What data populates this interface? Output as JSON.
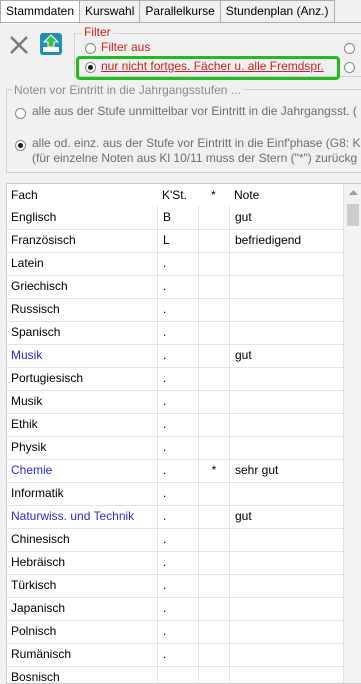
{
  "tabs": [
    "Stammdaten",
    "Kurswahl",
    "Parallelkurse",
    "Stundenplan (Anz.)"
  ],
  "filter": {
    "legend": "Filter",
    "option1": "Filter aus",
    "option2": "nur nicht fortges. Fächer u. alle Fremdspr."
  },
  "noten": {
    "legend": "Noten vor Eintritt in die Jahrgangsstufen ...",
    "option1": "alle aus der Stufe unmittelbar vor Eintritt in die Jahrgangsst. (",
    "option2_line1": "alle od. einz. aus der Stufe vor Eintritt in die Einf'phase (G8: K",
    "option2_line2": "(für einzelne Noten aus Kl 10/11 muss der Stern (\"*\") zurückg"
  },
  "table": {
    "headers": [
      "Fach",
      "K'St.",
      "*",
      "Note"
    ],
    "rows": [
      {
        "fach": "Englisch",
        "kst": "B",
        "star": "",
        "note": "gut",
        "blue": false
      },
      {
        "fach": "Französisch",
        "kst": "L",
        "star": "",
        "note": "befriedigend",
        "blue": false
      },
      {
        "fach": "Latein",
        "kst": ".",
        "star": "",
        "note": "",
        "blue": false
      },
      {
        "fach": "Griechisch",
        "kst": ".",
        "star": "",
        "note": "",
        "blue": false
      },
      {
        "fach": "Russisch",
        "kst": ".",
        "star": "",
        "note": "",
        "blue": false
      },
      {
        "fach": "Spanisch",
        "kst": ".",
        "star": "",
        "note": "",
        "blue": false
      },
      {
        "fach": "Musik",
        "kst": ".",
        "star": "",
        "note": "gut",
        "blue": true
      },
      {
        "fach": "Portugiesisch",
        "kst": ".",
        "star": "",
        "note": "",
        "blue": false
      },
      {
        "fach": "Musik",
        "kst": ".",
        "star": "",
        "note": "",
        "blue": false
      },
      {
        "fach": "Ethik",
        "kst": ".",
        "star": "",
        "note": "",
        "blue": false
      },
      {
        "fach": "Physik",
        "kst": ".",
        "star": "",
        "note": "",
        "blue": false
      },
      {
        "fach": "Chemie",
        "kst": ".",
        "star": "*",
        "note": "sehr gut",
        "blue": true
      },
      {
        "fach": "Informatik",
        "kst": ".",
        "star": "",
        "note": "",
        "blue": false
      },
      {
        "fach": "Naturwiss. und Technik",
        "kst": ".",
        "star": "",
        "note": "gut",
        "blue": true
      },
      {
        "fach": "Chinesisch",
        "kst": ".",
        "star": "",
        "note": "",
        "blue": false
      },
      {
        "fach": "Hebräisch",
        "kst": ".",
        "star": "",
        "note": "",
        "blue": false
      },
      {
        "fach": "Türkisch",
        "kst": ".",
        "star": "",
        "note": "",
        "blue": false
      },
      {
        "fach": "Japanisch",
        "kst": ".",
        "star": "",
        "note": "",
        "blue": false
      },
      {
        "fach": "Polnisch",
        "kst": ".",
        "star": "",
        "note": "",
        "blue": false
      },
      {
        "fach": "Rumänisch",
        "kst": ".",
        "star": "",
        "note": "",
        "blue": false
      },
      {
        "fach": "Bosnisch",
        "kst": "",
        "star": "",
        "note": "",
        "blue": false
      }
    ]
  },
  "colors": {
    "highlight": "#22bb22",
    "filter_red": "#d02020",
    "subject_blue": "#2a2ad6"
  },
  "icons": [
    "close-icon",
    "upload-icon"
  ]
}
